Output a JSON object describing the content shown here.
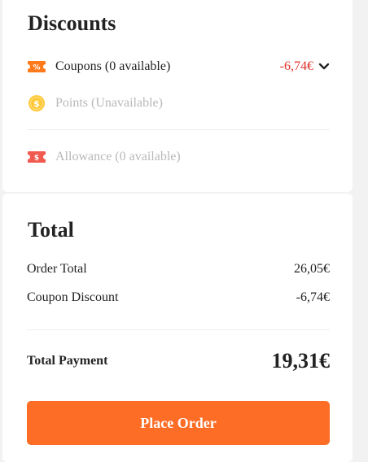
{
  "discounts": {
    "title": "Discounts",
    "coupons": {
      "label": "Coupons (0 available)",
      "value": "-6,74€",
      "icon": "coupon-ticket-icon",
      "icon_text": "%",
      "icon_color": "#ff7a1a"
    },
    "points": {
      "label": "Points (Unavailable)",
      "icon": "coin-icon",
      "icon_text": "$",
      "icon_color": "#ffc93a"
    },
    "allowance": {
      "label": "Allowance (0 available)",
      "icon": "allowance-ticket-icon",
      "icon_text": "$",
      "icon_color": "#f05a4f"
    }
  },
  "total": {
    "title": "Total",
    "order_total_label": "Order Total",
    "order_total_value": "26,05€",
    "coupon_discount_label": "Coupon Discount",
    "coupon_discount_value": "-6,74€",
    "payment_label": "Total Payment",
    "payment_value": "19,31€"
  },
  "actions": {
    "place_order_label": "Place Order"
  },
  "colors": {
    "accent": "#fd6d26",
    "discount_red": "#e0322a",
    "disabled_text": "#b8b8b8"
  }
}
